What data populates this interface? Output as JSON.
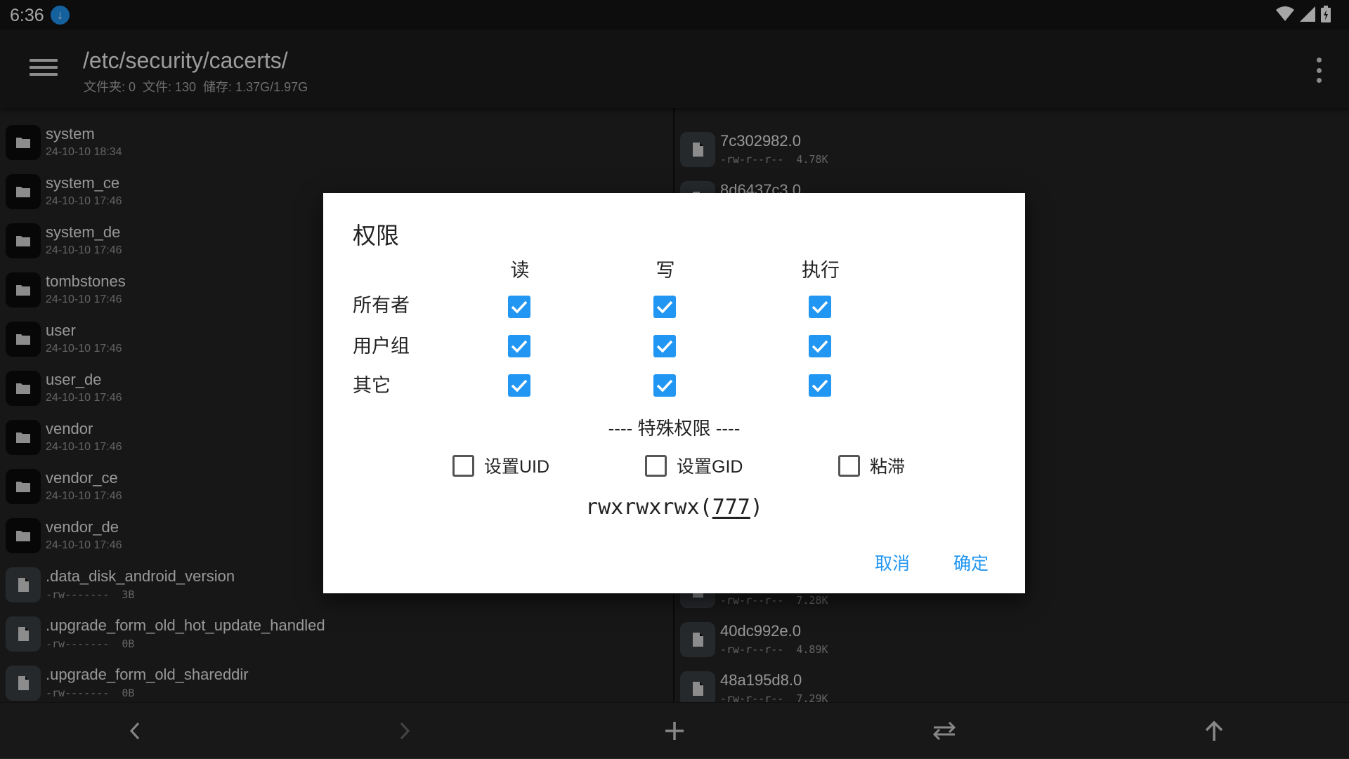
{
  "status_bar": {
    "time": "6:36",
    "download_badge": "download-icon"
  },
  "toolbar": {
    "path": "/etc/security/cacerts/",
    "stats": "文件夹: 0  文件: 130  储存: 1.37G/1.97G"
  },
  "left_pane": {
    "items": [
      {
        "name": "system",
        "meta": "24-10-10 18:34",
        "type": "folder"
      },
      {
        "name": "system_ce",
        "meta": "24-10-10 17:46",
        "type": "folder"
      },
      {
        "name": "system_de",
        "meta": "24-10-10 17:46",
        "type": "folder"
      },
      {
        "name": "tombstones",
        "meta": "24-10-10 17:46",
        "type": "folder"
      },
      {
        "name": "user",
        "meta": "24-10-10 17:46",
        "type": "folder"
      },
      {
        "name": "user_de",
        "meta": "24-10-10 17:46",
        "type": "folder"
      },
      {
        "name": "vendor",
        "meta": "24-10-10 17:46",
        "type": "folder"
      },
      {
        "name": "vendor_ce",
        "meta": "24-10-10 17:46",
        "type": "folder"
      },
      {
        "name": "vendor_de",
        "meta": "24-10-10 17:46",
        "type": "folder"
      },
      {
        "name": ".data_disk_android_version",
        "meta": "-rw-------  3B",
        "type": "file"
      },
      {
        "name": ".upgrade_form_old_hot_update_handled",
        "meta": "-rw-------  0B",
        "type": "file"
      },
      {
        "name": ".upgrade_form_old_shareddir",
        "meta": "-rw-------  0B",
        "type": "file"
      }
    ]
  },
  "right_pane": {
    "items": [
      {
        "name": "7c302982.0",
        "meta": "-rw-r--r--  4.78K",
        "type": "file"
      },
      {
        "name": "8d6437c3.0",
        "meta": "",
        "type": "file"
      },
      {
        "name": "",
        "meta": "-rw-r--r--  7.28K",
        "type": "file"
      },
      {
        "name": "40dc992e.0",
        "meta": "-rw-r--r--  4.89K",
        "type": "file"
      },
      {
        "name": "48a195d8.0",
        "meta": "-rw-r--r--  7.29K",
        "type": "file"
      }
    ]
  },
  "dialog": {
    "title": "权限",
    "columns": {
      "read": "读",
      "write": "写",
      "execute": "执行"
    },
    "rows": {
      "owner": "所有者",
      "group": "用户组",
      "others": "其它"
    },
    "checked": {
      "owner": [
        true,
        true,
        true
      ],
      "group": [
        true,
        true,
        true
      ],
      "others": [
        true,
        true,
        true
      ]
    },
    "special_title": "---- 特殊权限 ----",
    "special": {
      "setuid": "设置UID",
      "setgid": "设置GID",
      "sticky": "粘滞"
    },
    "special_checked": [
      false,
      false,
      false
    ],
    "perm_prefix": "rwxrwxrwx(",
    "perm_octal": "777",
    "perm_suffix": ")",
    "cancel": "取消",
    "ok": "确定"
  },
  "bottom_bar": {
    "buttons": [
      "back-icon",
      "forward-icon",
      "add-icon",
      "swap-icon",
      "up-icon"
    ]
  },
  "colors": {
    "accent": "#2196f3",
    "toolbar": "#1d1d1d",
    "pane": "#242424"
  }
}
